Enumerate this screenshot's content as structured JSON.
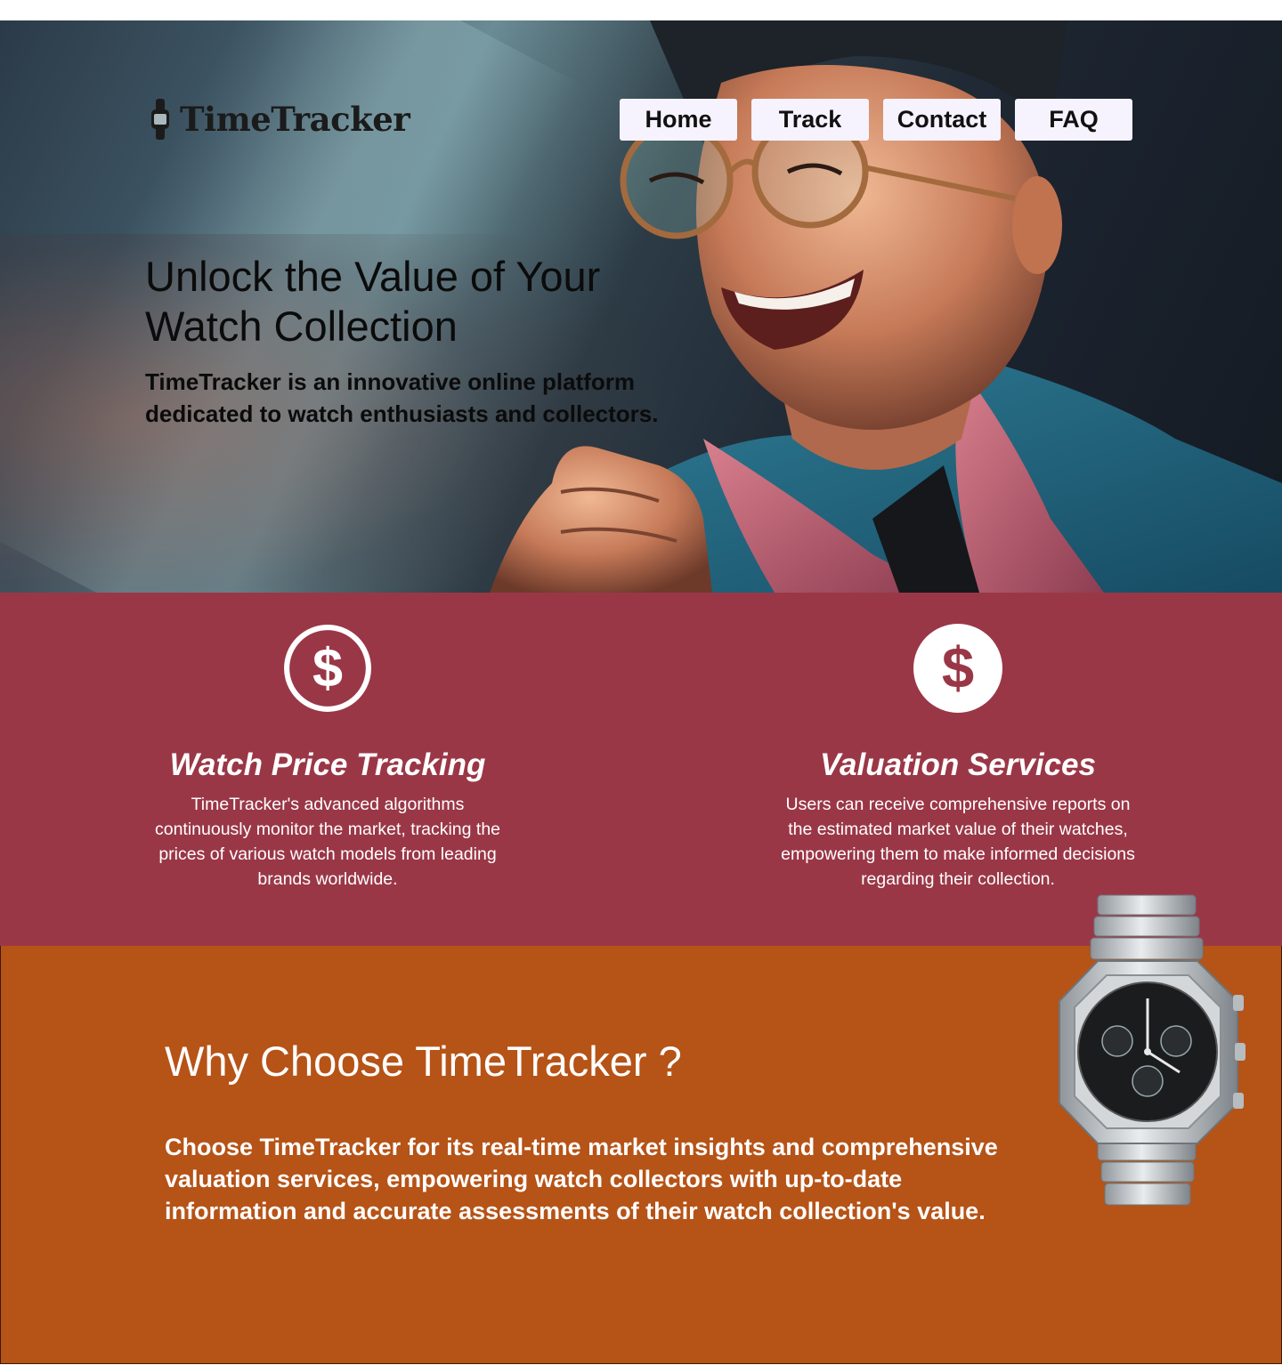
{
  "brand": {
    "name": "TimeTracker"
  },
  "nav": {
    "items": [
      {
        "label": "Home"
      },
      {
        "label": "Track"
      },
      {
        "label": "Contact"
      },
      {
        "label": "FAQ"
      }
    ]
  },
  "hero": {
    "title": "Unlock the Value of Your Watch Collection",
    "subtitle": "TimeTracker is an innovative online platform dedicated to watch enthusiasts and collectors.",
    "image_icon": "smiling-man-illustration"
  },
  "features": [
    {
      "icon": "dollar-circle-outline-icon",
      "title": "Watch Price Tracking",
      "text": "TimeTracker's advanced algorithms continuously monitor the market, tracking the prices of various watch models from leading brands worldwide."
    },
    {
      "icon": "dollar-circle-filled-icon",
      "title": "Valuation Services",
      "text": "Users can receive comprehensive reports on the estimated market value of their watches, empowering them to make informed decisions regarding their collection."
    }
  ],
  "why": {
    "title": "Why Choose TimeTracker ?",
    "text": "Choose TimeTracker for its real-time market insights and comprehensive valuation services, empowering watch collectors with up-to-date information and accurate assessments of their watch collection's value.",
    "image_icon": "luxury-watch-image"
  },
  "colors": {
    "features_bg": "#9a3747",
    "why_bg": "#b65317",
    "nav_button_bg": "#f6f3ff"
  }
}
